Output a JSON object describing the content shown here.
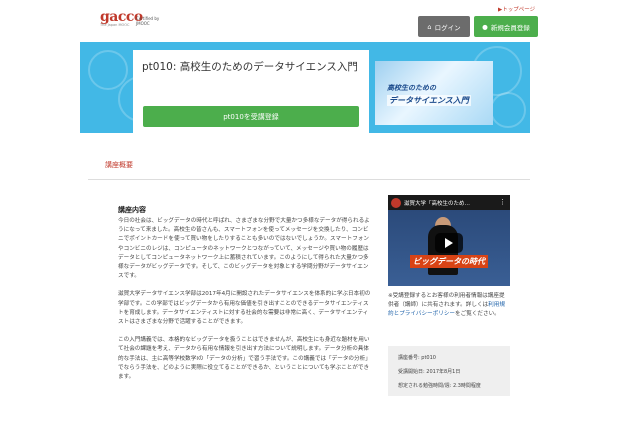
{
  "header": {
    "logo_text": "gacco",
    "logo_tagline": "The Japan MOOC",
    "certified_text": "Certified by JMOOC",
    "top_link": "▶トップページ",
    "login_label": "ログイン",
    "register_label": "新規会員登録"
  },
  "hero": {
    "course_title": "pt010: 高校生のためのデータサイエンス入門",
    "enroll_label": "pt010を受講登録",
    "thumb_line1": "高校生のための",
    "thumb_line2": "データサイエンス入門"
  },
  "section": {
    "tab_label": "講座概要"
  },
  "content": {
    "heading": "講座内容",
    "para1": "今日の社会は、ビッグデータの時代と呼ばれ、さまざまな分野で大量かつ多様なデータが得られるようになって来ました。高校生の皆さんも、スマートフォンを使ってメッセージを交換したり、コンビニでポイントカードを使って買い物をしたりすることも多いのではないでしょうか。スマートフォンやコンビニのレジは、コンピュータのネットワークとつながっていて、メッセージや買い物の履歴はデータとしてコンピュータネットワーク上に蓄積されています。このようにして得られた大量かつ多様なデータがビッグデータです。そして、このビッグデータを対象とする学問分野がデータサイエンスです。",
    "para2": "滋賀大学データサイエンス学部は2017年4月に開設されたデータサイエンスを体系的に学ぶ日本初の学部です。この学部ではビッグデータから有用な価値を引き出すことのできるデータサイエンティストを育成します。データサイエンティストに対する社会的な需要は非常に高く、データサイエンティストはさまざまな分野で活躍することができます。",
    "para3": "この入門講義では、本格的なビッグデータを扱うことはできませんが、高校生にも身近な題材を用いて社会の課題を考え、データから有用な情報を引き出す方法について説明します。データ分析の具体的な手法は、主に高等学校数学Ⅰの「データの分析」で習う手法です。この講義では「データの分析」でならう手法を、どのように実際に役立てることができるか、ということについても学ぶことができます。"
  },
  "video": {
    "title": "滋賀大学「高校生のため…",
    "caption": "ビッグデータの時代"
  },
  "sidebar": {
    "note_prefix": "※受講登録するとお客様の利用者情報は講座提供者（講師）に共有されます。詳しくは",
    "note_link": "利用規約とプライバシーポリシー",
    "note_suffix": "をご覧ください。"
  },
  "info": {
    "course_number": "講座番号: pt010",
    "start_date": "受講開始日: 2017年8月1日",
    "study_time": "想定される勉強時間/週: 2.3時間程度"
  }
}
